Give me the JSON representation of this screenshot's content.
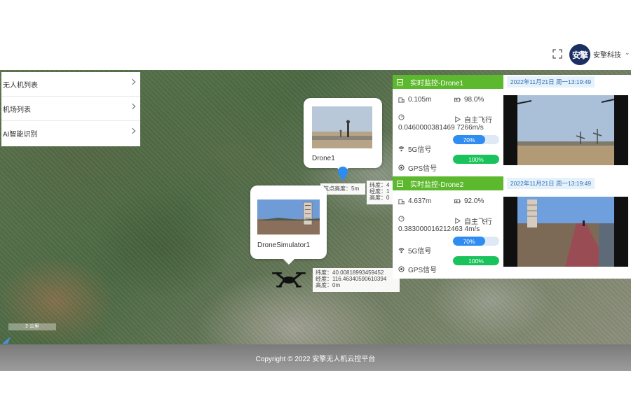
{
  "header": {
    "user_name": "安擎科技",
    "avatar_text": "安擎"
  },
  "side_menu": {
    "items": [
      {
        "label": "无人机列表"
      },
      {
        "label": "机场列表"
      },
      {
        "label": "AI智能识别"
      }
    ]
  },
  "map": {
    "drone1_popup": {
      "label": "Drone1"
    },
    "drone1_info": {
      "line1": "航点高度：5m",
      "line2": "纬度：4",
      "line3": "经度：1",
      "line4": "高度：0"
    },
    "simulator_popup": {
      "label": "DroneSimulator1"
    },
    "simulator_info": {
      "lat": "纬度：40.00818993459452",
      "lng": "经度：116.46340590610394",
      "alt": "高度：0m"
    },
    "scale_text": "2 公里"
  },
  "monitors": [
    {
      "title": "实时监控-Drone1",
      "date": "2022年11月21日 周一13:19:49",
      "height": "0.105m",
      "battery": "98.0%",
      "mode": "自主飞行",
      "speed": "0.0460000381469 7266m/s",
      "signal_5g_label": "5G信号",
      "signal_5g_value": "70%",
      "signal_5g_pct": 70,
      "gps_label": "GPS信号",
      "gps_value": "100%",
      "gps_pct": 100
    },
    {
      "title": "实时监控-Drone2",
      "date": "2022年11月21日 周一13:19:49",
      "height": "4.637m",
      "battery": "92.0%",
      "mode": "自主飞行",
      "speed": "0.383000016212463 4m/s",
      "signal_5g_label": "5G信号",
      "signal_5g_value": "70%",
      "signal_5g_pct": 70,
      "gps_label": "GPS信号",
      "gps_value": "100%",
      "gps_pct": 100
    }
  ],
  "zoom": {
    "in_label": "+",
    "out_label": "-"
  },
  "footer": {
    "copyright": "Copyright © 2022 安擎无人机云控平台"
  },
  "colors": {
    "accent_green": "#5cb82c",
    "progress_blue": "#2f8cf0",
    "progress_green": "#19c25a",
    "date_blue": "#2f6fb3"
  }
}
